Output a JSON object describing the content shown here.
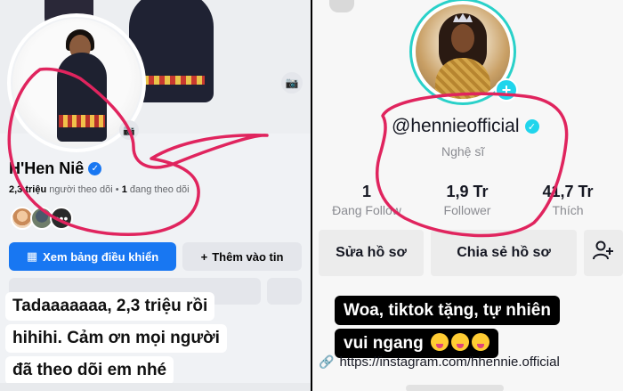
{
  "facebook": {
    "name": "H'Hen Niê",
    "followers_count": "2,3 triệu",
    "followers_label": "người theo dõi",
    "separator": " • ",
    "following_count": "1",
    "following_label": "đang theo dõi",
    "primary_button_label": "Xem bảng điều khiển",
    "secondary_button_label": "Thêm vào tin",
    "caption_lines": [
      "Tadaaaaaaa, 2,3 triệu rồi",
      "hihihi. Cảm ơn mọi người",
      "đã theo dõi em nhé"
    ]
  },
  "tiktok": {
    "handle": "@hennieofficial",
    "role": "Nghệ sĩ",
    "stats": [
      {
        "value": "1",
        "label": "Đang Follow"
      },
      {
        "value": "1,9 Tr",
        "label": "Follower"
      },
      {
        "value": "41,7 Tr",
        "label": "Thích"
      }
    ],
    "edit_profile_label": "Sửa hồ sơ",
    "share_profile_label": "Chia sẻ hồ sơ",
    "add_friend_icon": "add-user-icon",
    "caption_lines": [
      "Woa, tiktok tặng, tự nhiên",
      "vui ngang"
    ],
    "link": "https://instagram.com/hhennie.official"
  },
  "colors": {
    "facebook_blue": "#1877f2",
    "tiktok_cyan": "#20d5ec",
    "annotation_red": "#e0245e"
  }
}
